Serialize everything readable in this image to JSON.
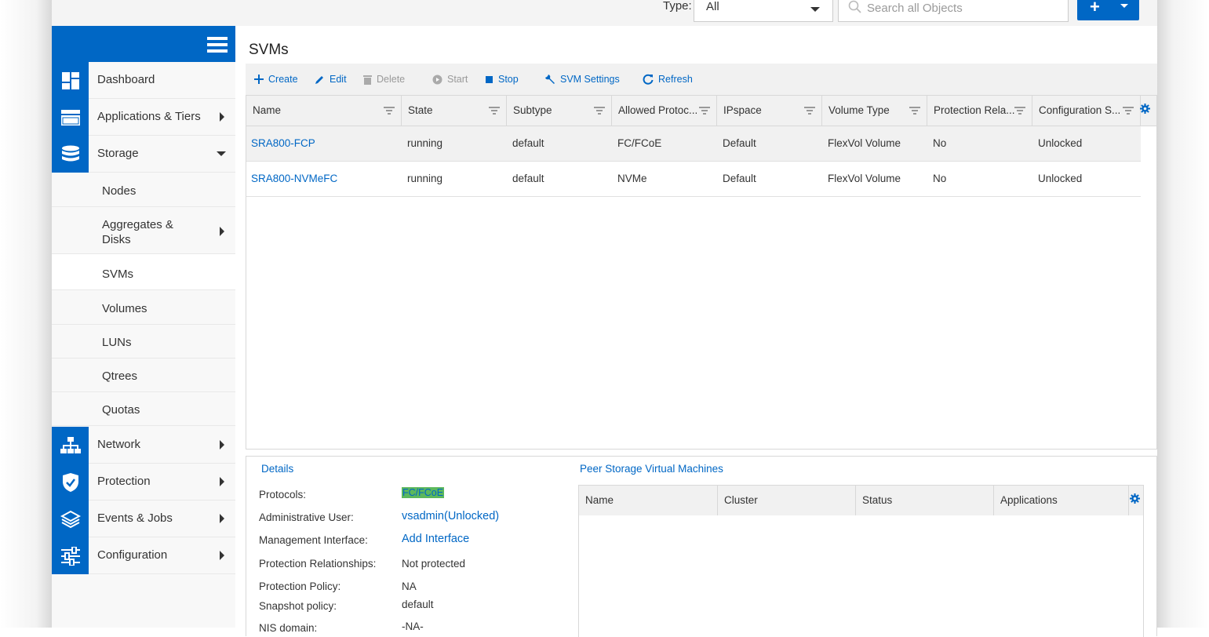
{
  "header": {
    "type_label": "Type:",
    "type_value": "All",
    "search_placeholder": "Search all Objects",
    "add_label": "+"
  },
  "sidebar": {
    "items": [
      {
        "label": "Dashboard",
        "icon": "dashboard-icon"
      },
      {
        "label": "Applications & Tiers",
        "icon": "applications-icon"
      },
      {
        "label": "Storage",
        "icon": "storage-icon"
      },
      {
        "label": "Network",
        "icon": "network-icon"
      },
      {
        "label": "Protection",
        "icon": "shield-icon"
      },
      {
        "label": "Events & Jobs",
        "icon": "layers-icon"
      },
      {
        "label": "Configuration",
        "icon": "sliders-icon"
      }
    ],
    "storage_sub": [
      {
        "label": "Nodes"
      },
      {
        "label": "Aggregates &"
      },
      {
        "label": "Disks"
      },
      {
        "label": "SVMs"
      },
      {
        "label": "Volumes"
      },
      {
        "label": "LUNs"
      },
      {
        "label": "Qtrees"
      },
      {
        "label": "Quotas"
      }
    ]
  },
  "page": {
    "title": "SVMs"
  },
  "toolbar": {
    "create": "Create",
    "edit": "Edit",
    "delete": "Delete",
    "start": "Start",
    "stop": "Stop",
    "svm_settings": "SVM Settings",
    "refresh": "Refresh"
  },
  "table": {
    "columns": [
      "Name",
      "State",
      "Subtype",
      "Allowed Protoc...",
      "IPspace",
      "Volume Type",
      "Protection Rela...",
      "Configuration S..."
    ],
    "rows": [
      [
        "SRA800-FCP",
        "running",
        "default",
        "FC/FCoE",
        "Default",
        "FlexVol Volume",
        "No",
        "Unlocked"
      ],
      [
        "SRA800-NVMeFC",
        "running",
        "default",
        "NVMe",
        "Default",
        "FlexVol Volume",
        "No",
        "Unlocked"
      ]
    ]
  },
  "details": {
    "title": "Details",
    "fields": [
      {
        "label": "Protocols:",
        "value": "FC/FCoE"
      },
      {
        "label": "Administrative User:",
        "value": "vsadmin(Unlocked)"
      },
      {
        "label": "Management Interface:",
        "value": "Add Interface"
      },
      {
        "label": "Protection Relationships:",
        "value": "Not protected"
      },
      {
        "label": "Protection Policy:",
        "value": "NA"
      },
      {
        "label": "Snapshot policy:",
        "value": "default"
      },
      {
        "label": "NIS domain:",
        "value": "-NA-"
      }
    ]
  },
  "peer": {
    "title": "Peer Storage Virtual Machines",
    "columns": [
      "Name",
      "Cluster",
      "Status",
      "Applications"
    ]
  },
  "colors": {
    "accent": "#0067c5",
    "header_bg": "#f1f1f1",
    "highlight": "#5cb85c"
  }
}
